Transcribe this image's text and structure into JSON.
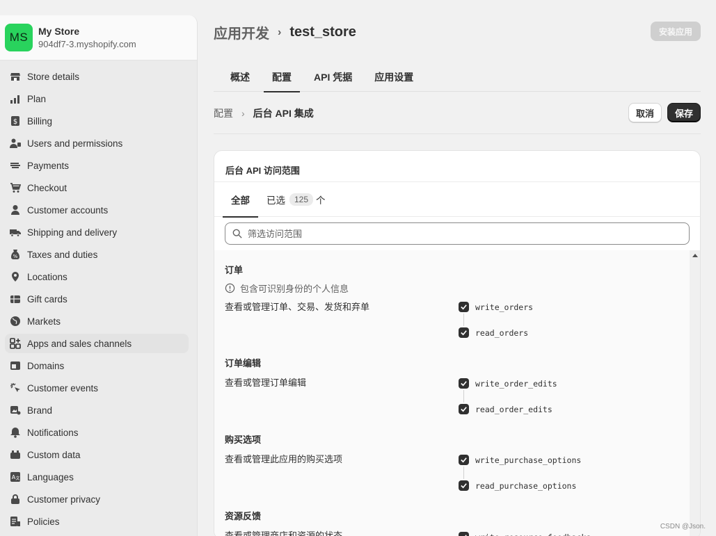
{
  "store": {
    "initials": "MS",
    "name": "My Store",
    "domain": "904df7-3.myshopify.com"
  },
  "sidebar": {
    "items": [
      {
        "label": "Store details",
        "icon": "store-icon"
      },
      {
        "label": "Plan",
        "icon": "plan-icon"
      },
      {
        "label": "Billing",
        "icon": "billing-icon"
      },
      {
        "label": "Users and permissions",
        "icon": "users-icon"
      },
      {
        "label": "Payments",
        "icon": "payments-icon"
      },
      {
        "label": "Checkout",
        "icon": "cart-icon"
      },
      {
        "label": "Customer accounts",
        "icon": "person-icon"
      },
      {
        "label": "Shipping and delivery",
        "icon": "truck-icon"
      },
      {
        "label": "Taxes and duties",
        "icon": "tax-icon"
      },
      {
        "label": "Locations",
        "icon": "location-icon"
      },
      {
        "label": "Gift cards",
        "icon": "gift-card-icon"
      },
      {
        "label": "Markets",
        "icon": "globe-icon"
      },
      {
        "label": "Apps and sales channels",
        "icon": "apps-icon",
        "active": true
      },
      {
        "label": "Domains",
        "icon": "domains-icon"
      },
      {
        "label": "Customer events",
        "icon": "cursor-icon"
      },
      {
        "label": "Brand",
        "icon": "brand-icon"
      },
      {
        "label": "Notifications",
        "icon": "bell-icon"
      },
      {
        "label": "Custom data",
        "icon": "data-icon"
      },
      {
        "label": "Languages",
        "icon": "language-icon"
      },
      {
        "label": "Customer privacy",
        "icon": "lock-icon"
      },
      {
        "label": "Policies",
        "icon": "policies-icon"
      }
    ]
  },
  "header": {
    "parent": "应用开发",
    "current": "test_store",
    "install_label": "安装应用"
  },
  "tabs": [
    "概述",
    "配置",
    "API 凭据",
    "应用设置"
  ],
  "active_tab": "配置",
  "subcrumb": {
    "parent": "配置",
    "current": "后台 API 集成"
  },
  "actions": {
    "cancel": "取消",
    "save": "保存"
  },
  "card": {
    "title": "后台 API 访问范围",
    "tab_all": "全部",
    "tab_selected": "已选",
    "selected_count": "125",
    "selected_suffix": "个",
    "search_placeholder": "筛选访问范围"
  },
  "sections": [
    {
      "title": "订单",
      "pii": "包含可识别身份的个人信息",
      "description": "查看或管理订单、交易、发货和弃单",
      "write": "write_orders",
      "read": "read_orders"
    },
    {
      "title": "订单编辑",
      "description": "查看或管理订单编辑",
      "write": "write_order_edits",
      "read": "read_order_edits"
    },
    {
      "title": "购买选项",
      "description": "查看或管理此应用的购买选项",
      "write": "write_purchase_options",
      "read": "read_purchase_options"
    },
    {
      "title": "资源反馈",
      "description": "查看或管理商店和资源的状态",
      "write": "write_resource_feedbacks"
    }
  ],
  "watermark": "CSDN @Json."
}
